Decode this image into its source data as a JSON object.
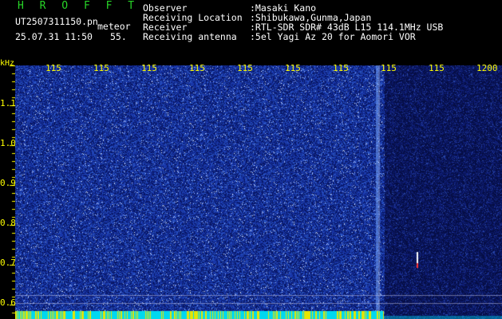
{
  "app": {
    "name": "H R O F F T"
  },
  "file": {
    "name": "UT2507311150.pn",
    "tag": "meteor",
    "datetime": "25.07.31 11:50",
    "count": "55."
  },
  "info": {
    "observer_label": "Observer",
    "observer_value": ":Masaki Kano",
    "location_label": "Receiving Location",
    "location_value": ":Shibukawa,Gunma,Japan",
    "receiver_label": "Receiver",
    "receiver_value": ":RTL-SDR SDR# 43dB L15 114.1MHz USB",
    "antenna_label": "Receiving antenna",
    "antenna_value": ":5el Yagi Az 20 for Aomori VOR"
  },
  "time_axis": {
    "unit": "kHz",
    "labels": [
      "115",
      "115",
      "115",
      "115",
      "115",
      "115",
      "115",
      "115",
      "115",
      "1200"
    ]
  },
  "freq_axis": {
    "labels": [
      "1.1",
      "1.0",
      "0.9",
      "0.8",
      "0.7",
      "0.6"
    ]
  },
  "colors": {
    "title": "#28d628",
    "axis": "#ffff00",
    "text": "#ffffff",
    "noise": "#1a3aa8",
    "bottom": "#00e5ff"
  }
}
